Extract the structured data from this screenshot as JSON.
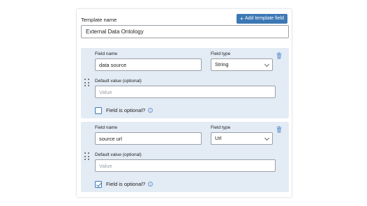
{
  "template": {
    "name_label": "Template name",
    "name_value": "External Data Ontology",
    "add_button_label": "Add template field",
    "add_button_icon": "plus-icon"
  },
  "colors": {
    "accent": "#3b78b4",
    "card_bg": "#e3ebf5"
  },
  "fields": [
    {
      "field_name_label": "Field name",
      "field_name_value": "data source",
      "field_type_label": "Field type",
      "field_type_value": "String",
      "default_label": "Default value (optional)",
      "default_placeholder": "Value",
      "optional_label": "Field is optional?",
      "optional_checked": false
    },
    {
      "field_name_label": "Field name",
      "field_name_value": "source url",
      "field_type_label": "Field type",
      "field_type_value": "Url",
      "default_label": "Default value (optional)",
      "default_placeholder": "Value",
      "optional_label": "Field is optional?",
      "optional_checked": true
    }
  ]
}
